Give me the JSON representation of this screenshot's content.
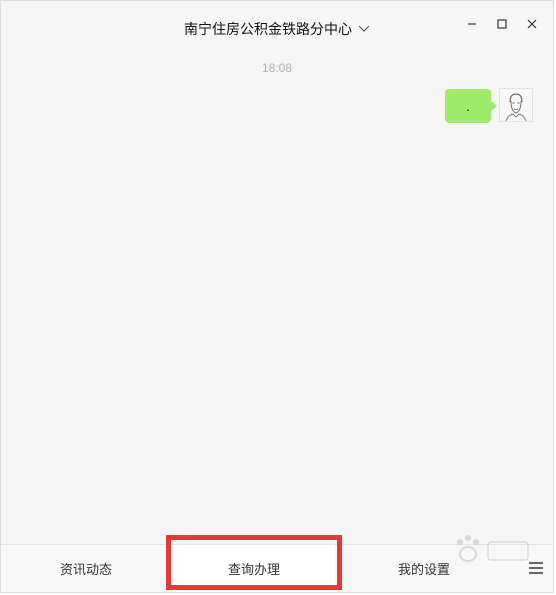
{
  "window": {
    "title": "南宁住房公积金铁路分中心"
  },
  "chat": {
    "timestamp": "18:08",
    "messages": [
      {
        "text": ".",
        "from": "self"
      }
    ]
  },
  "menu": {
    "items": [
      {
        "label": "资讯动态"
      },
      {
        "label": "查询办理"
      },
      {
        "label": "我的设置"
      }
    ]
  },
  "colors": {
    "bubble": "#9eea6a",
    "highlight_border": "#e53935",
    "window_bg": "#f5f5f5"
  },
  "icons": {
    "title_dropdown": "chevron-down-icon",
    "minimize": "minimize-icon",
    "maximize": "maximize-icon",
    "close": "close-icon",
    "menu_toggle": "hamburger-icon"
  }
}
